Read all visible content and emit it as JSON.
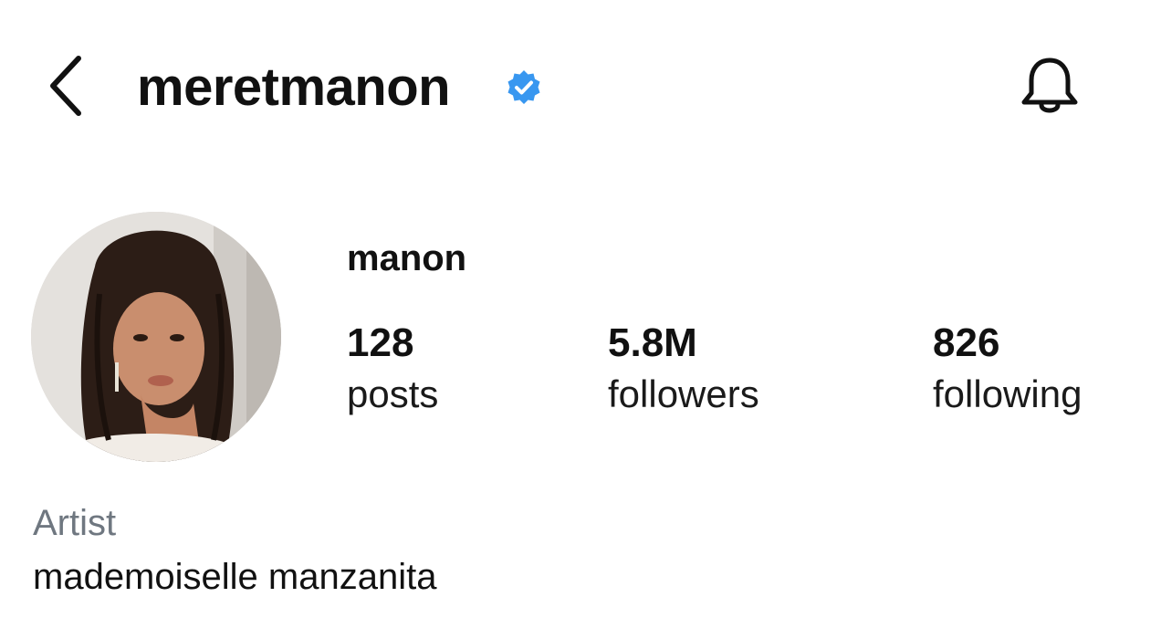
{
  "header": {
    "username": "meretmanon",
    "verified": true,
    "back_icon": "chevron-left-icon",
    "bell_icon": "bell-icon",
    "verified_color": "#3897f0"
  },
  "profile": {
    "display_name": "manon",
    "avatar": "profile-photo",
    "stats": {
      "posts_count": "128",
      "posts_label": "posts",
      "followers_count": "5.8M",
      "followers_label": "followers",
      "following_count": "826",
      "following_label": "following"
    },
    "category": "Artist",
    "bio": "mademoiselle manzanita"
  }
}
